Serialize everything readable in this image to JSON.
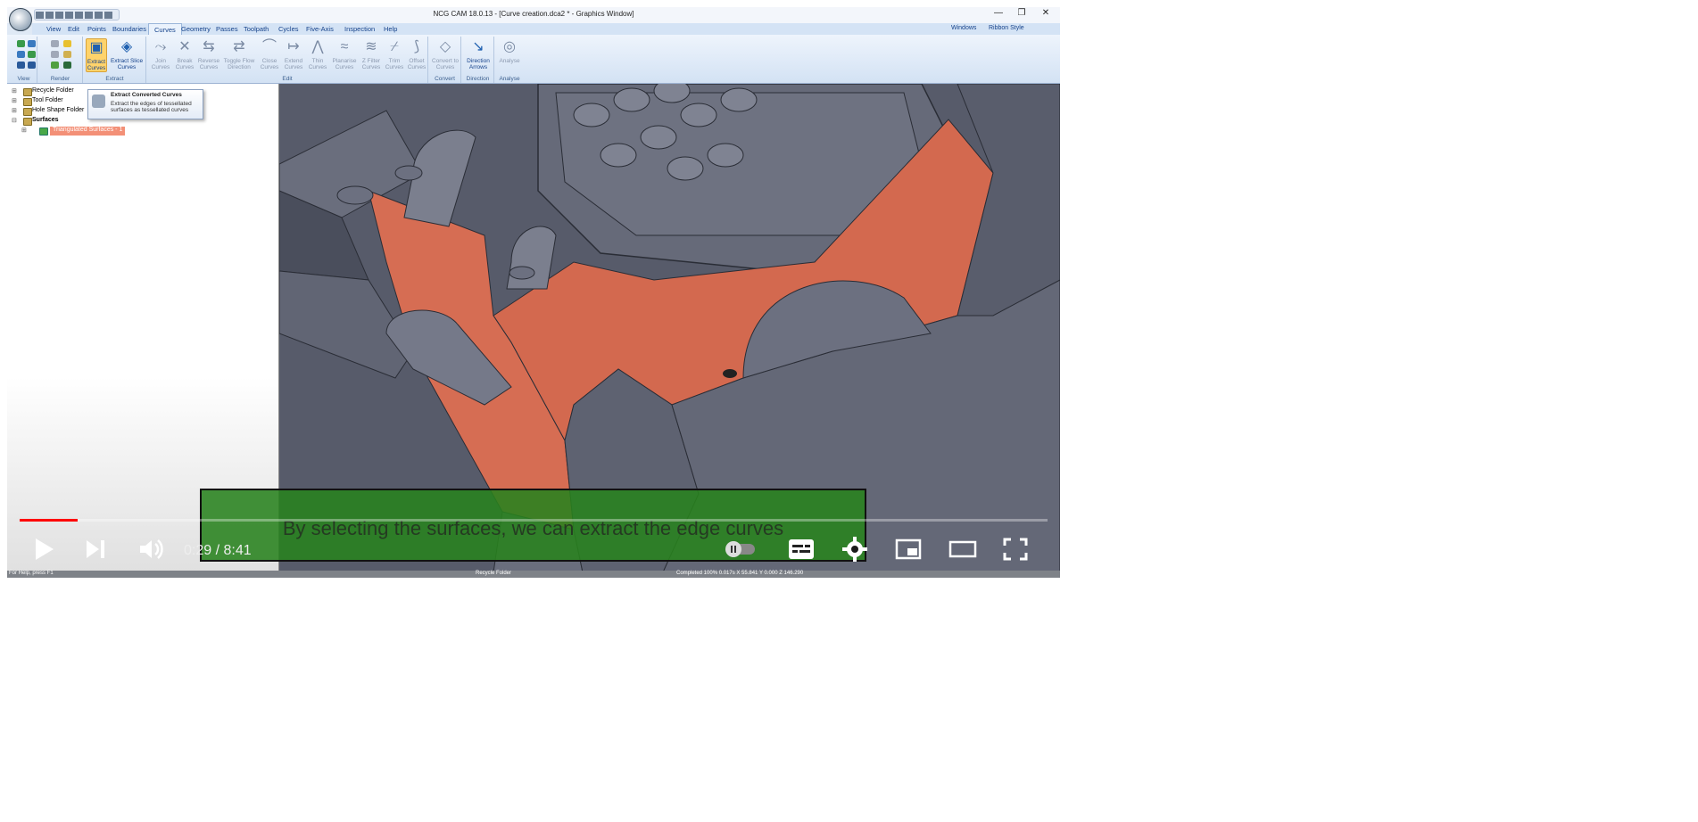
{
  "window": {
    "title": "NCG CAM 18.0.13 - [Curve creation.dca2 * - Graphics Window]",
    "minimize": "—",
    "restore": "❐",
    "close": "✕"
  },
  "menu": {
    "items": [
      "View",
      "Edit",
      "Points",
      "Boundaries",
      "Curves",
      "Geometry",
      "Passes",
      "Toolpath",
      "Cycles",
      "Five-Axis",
      "Inspection",
      "Help"
    ],
    "right": [
      "Windows",
      "Ribbon Style"
    ]
  },
  "ribbon": {
    "groups": [
      "View",
      "Render",
      "Extract",
      "Edit",
      "Convert",
      "Direction",
      "Analyse"
    ],
    "extract_curves": "Extract Curves",
    "extract_slice": "Extract Slice Curves",
    "edit_buttons": [
      "Join Curves",
      "Break Curves",
      "Reverse Curves",
      "Toggle Flow Direction",
      "Close Curves",
      "Extend Curves",
      "Thin Curves",
      "Planarise Curves",
      "Z Filter Curves",
      "Trim Curves",
      "Offset Curves"
    ],
    "convert_button": "Convert to Curves",
    "direction_button": "Direction Arrows",
    "analyse_button": "Analyse"
  },
  "tooltip": {
    "title": "Extract Converted Curves",
    "description": "Extract the edges of tessellated surfaces as tessellated curves"
  },
  "tree": {
    "items": [
      "Recycle Folder",
      "Tool Folder",
      "Hole Shape Folder",
      "Surfaces"
    ],
    "selected": "Triangulated Surfaces - 1"
  },
  "status": {
    "help": "For Help, press F1",
    "folder": "Recycle Folder",
    "coords": "Completed 100% 0.017s X 55.841 Y 0.000 Z 146.290"
  },
  "player": {
    "caption": "By selecting the surfaces, we can extract the edge curves",
    "time": "0:29 / 8:41",
    "progress": 0.056,
    "colors": {
      "progress": "#ff0000",
      "caption_bg": "#2a8a1e",
      "highlight": "#e0715a"
    }
  }
}
